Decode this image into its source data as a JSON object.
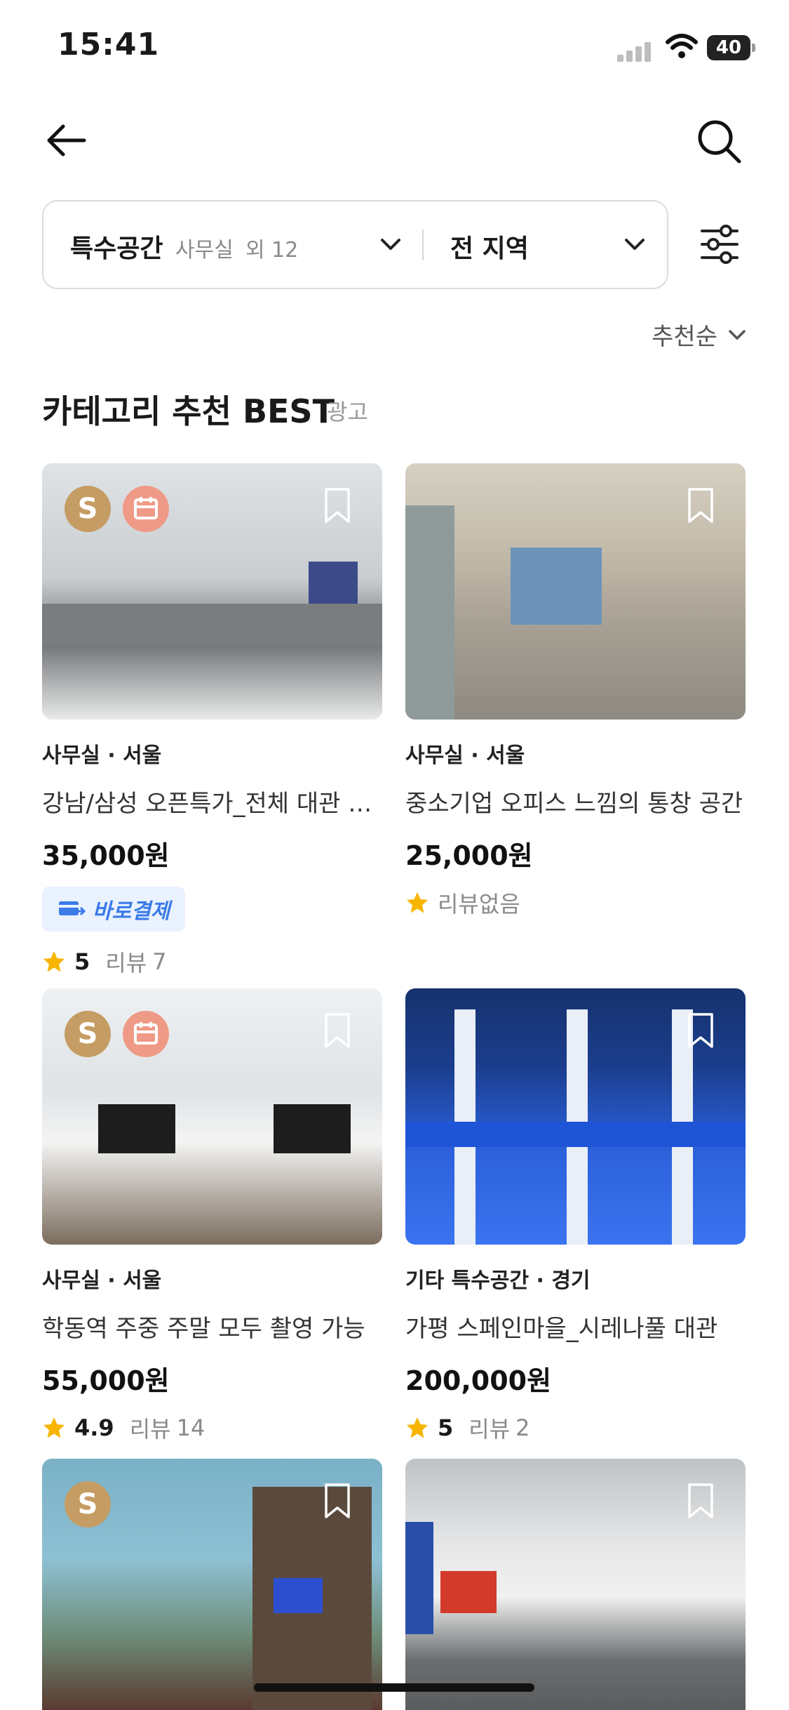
{
  "status": {
    "time": "15:41",
    "battery": "40"
  },
  "filters": {
    "category": "특수공간",
    "category_sub": "사무실",
    "category_more": "외 12",
    "region": "전 지역"
  },
  "sort": {
    "label": "추천순"
  },
  "section": {
    "title": "카테고리 추천 BEST",
    "ad_label": "광고"
  },
  "cards": [
    {
      "meta": "사무실 · 서울",
      "title": "강남/삼성 오픈특가_전체 대관 공간",
      "price": "35,000원",
      "pay_label": "바로결제",
      "rating": "5",
      "review_label": "리뷰",
      "review_count": "7",
      "badge": "S",
      "colors": {
        "top": "#d9dde0",
        "bottom": "#8c8f92"
      }
    },
    {
      "meta": "사무실 · 서울",
      "title": "중소기업 오피스 느낌의 통창 공간",
      "price": "25,000원",
      "no_review": "리뷰없음",
      "colors": {
        "top": "#cfc7b7",
        "bottom": "#9a948a"
      }
    },
    {
      "meta": "사무실 · 서울",
      "title": "학동역 주중 주말 모두 촬영 가능",
      "price": "55,000원",
      "rating": "4.9",
      "review_label": "리뷰",
      "review_count": "14",
      "badge": "S",
      "colors": {
        "top": "#e6eaee",
        "bottom": "#7d7366"
      }
    },
    {
      "meta": "기타 특수공간 · 경기",
      "title": "가평 스페인마을_시레나풀 대관",
      "price": "200,000원",
      "rating": "5",
      "review_label": "리뷰",
      "review_count": "2",
      "colors": {
        "top": "#1c4fb8",
        "bottom": "#2f63e0"
      }
    },
    {
      "colors": {
        "top": "#8ebccf",
        "bottom": "#6b3f34"
      },
      "badge": "S"
    },
    {
      "colors": {
        "top": "#d8dadb",
        "bottom": "#6c6f70"
      }
    }
  ],
  "accent": {
    "star": "#f7b500",
    "pay": "#3b7be8",
    "badge_s": "#c59c63",
    "badge_cal": "#ef9a86"
  }
}
